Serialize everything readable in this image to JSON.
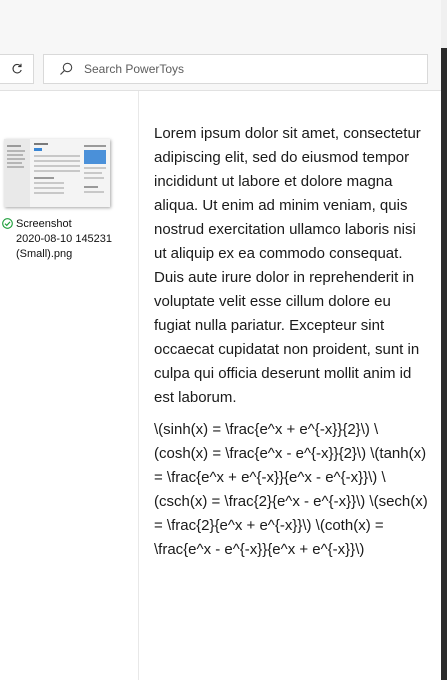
{
  "search": {
    "placeholder": "Search PowerToys"
  },
  "file": {
    "name_line1": "Screenshot",
    "name_line2": "2020-08-10 145231",
    "name_line3": "(Small).png",
    "status": "synced"
  },
  "preview": {
    "paragraph1": "Lorem ipsum dolor sit amet, consectetur adipiscing elit, sed do eiusmod tempor incididunt ut labore et dolore magna aliqua. Ut enim ad minim veniam, quis nostrud exercitation ullamco laboris nisi ut aliquip ex ea commodo consequat. Duis aute irure dolor in reprehenderit in voluptate velit esse cillum dolore eu fugiat nulla pariatur. Excepteur sint occaecat cupidatat non proident, sunt in culpa qui officia deserunt mollit anim id est laborum.",
    "paragraph2": "\\(sinh(x) = \\frac{e^x + e^{-x}}{2}\\) \\(cosh(x) = \\frac{e^x - e^{-x}}{2}\\) \\(tanh(x) = \\frac{e^x + e^{-x}}{e^x - e^{-x}}\\) \\(csch(x) = \\frac{2}{e^x - e^{-x}}\\) \\(sech(x) = \\frac{2}{e^x + e^{-x}}\\) \\(coth(x) = \\frac{e^x - e^{-x}}{e^x + e^{-x}}\\)"
  },
  "icons": {
    "refresh": "refresh-icon",
    "search": "search-icon",
    "sync_status": "check-circle-icon"
  },
  "colors": {
    "sync_green": "#1e9e3a",
    "accent": "#0078d4"
  }
}
